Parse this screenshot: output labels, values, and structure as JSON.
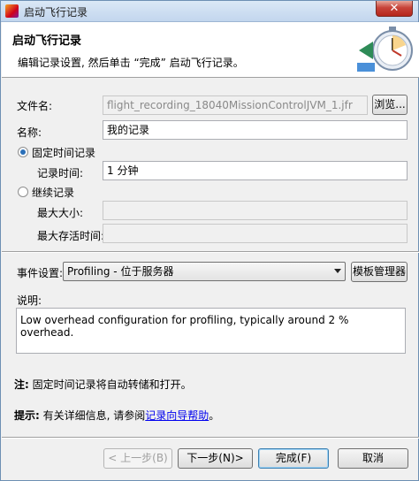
{
  "window": {
    "title": "启动飞行记录",
    "close_glyph": "✕"
  },
  "header": {
    "title": "启动飞行记录",
    "description": "编辑记录设置, 然后单击 “完成” 启动飞行记录。",
    "icon": "stopwatch-record-icon"
  },
  "form": {
    "filename_label": "文件名:",
    "filename_value": "flight_recording_18040MissionControlJVM_1.jfr",
    "browse_label": "浏览...",
    "name_label": "名称:",
    "name_value": "我的记录",
    "fixed_label": "固定时间记录",
    "duration_label": "记录时间:",
    "duration_value": "1 分钟",
    "continuous_label": "继续记录",
    "max_size_label": "最大大小:",
    "max_size_value": "",
    "max_age_label": "最大存活时间:",
    "max_age_value": "",
    "events_label": "事件设置:",
    "events_value": "Profiling - 位于服务器",
    "template_manager_label": "模板管理器",
    "description_label": "说明:",
    "description_value": "Low overhead configuration for profiling, typically around 2 % overhead."
  },
  "notes": {
    "note_prefix": "注:",
    "note_text": " 固定时间记录将自动转储和打开。",
    "tip_prefix": "提示:",
    "tip_text": " 有关详细信息, 请参阅",
    "tip_link": "记录向导帮助",
    "tip_suffix": "。"
  },
  "buttons": {
    "back": "< 上一步(B)",
    "next": "下一步(N)>",
    "finish": "完成(F)",
    "cancel": "取消"
  }
}
